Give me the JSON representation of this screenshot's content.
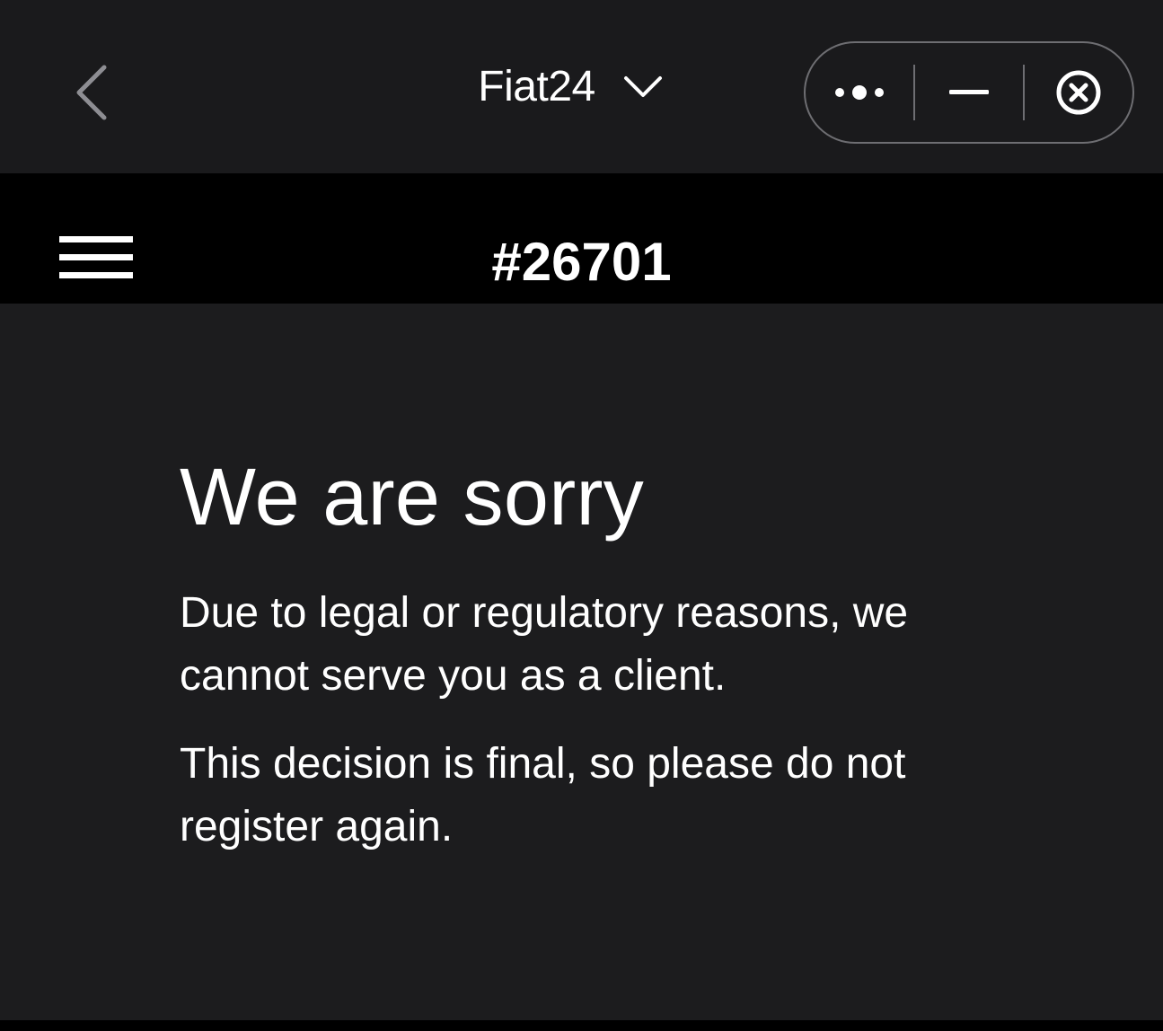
{
  "topbar": {
    "title": "Fiat24",
    "icons": {
      "back": "chevron-left-icon",
      "title_dropdown": "chevron-down-icon",
      "more": "more-dots-icon",
      "minimize": "minimize-icon",
      "close": "close-circle-icon"
    }
  },
  "header": {
    "menu_icon": "hamburger-icon",
    "account_number": "#26701"
  },
  "main": {
    "headline": "We are sorry",
    "paragraphs": [
      "Due to legal or regulatory reasons, we cannot serve you as a client.",
      "This decision is final, so please do not register again."
    ]
  },
  "colors": {
    "topbar_bg": "#1a1a1c",
    "header_bg": "#000000",
    "content_bg": "#1c1c1e",
    "text": "#ffffff",
    "capsule_border": "#6e6e72"
  }
}
